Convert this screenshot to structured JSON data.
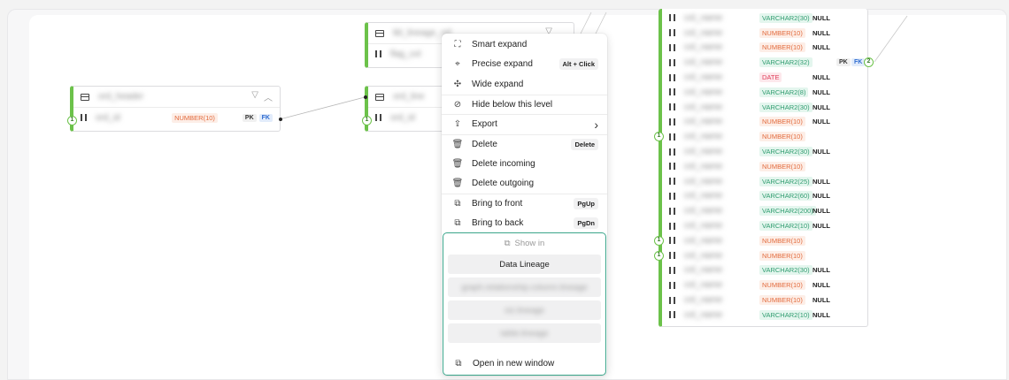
{
  "menu": {
    "items": [
      {
        "icon": "smart-expand-icon",
        "glyph": "⛶",
        "label": "Smart expand",
        "shortcut": ""
      },
      {
        "icon": "precise-expand-icon",
        "glyph": "⌖",
        "label": "Precise expand",
        "shortcut": "Alt + Click"
      },
      {
        "icon": "wide-expand-icon",
        "glyph": "✣",
        "label": "Wide expand",
        "shortcut": ""
      },
      {
        "icon": "eye-off-icon",
        "glyph": "⊘",
        "label": "Hide below this level",
        "shortcut": ""
      },
      {
        "icon": "export-icon",
        "glyph": "⇪",
        "label": "Export",
        "shortcut": "›"
      },
      {
        "icon": "trash-icon",
        "glyph": "🗑",
        "label": "Delete",
        "shortcut": "Delete"
      },
      {
        "icon": "trash-icon",
        "glyph": "🗑",
        "label": "Delete incoming",
        "shortcut": ""
      },
      {
        "icon": "trash-icon",
        "glyph": "🗑",
        "label": "Delete outgoing",
        "shortcut": ""
      },
      {
        "icon": "bring-front-icon",
        "glyph": "⧉",
        "label": "Bring to front",
        "shortcut": "PgUp"
      },
      {
        "icon": "send-back-icon",
        "glyph": "⧉",
        "label": "Bring to back",
        "shortcut": "PgDn"
      }
    ],
    "show_in": {
      "title": "Show in",
      "options": [
        "Data Lineage"
      ]
    },
    "open_new_window": "Open in new window"
  },
  "nodes": {
    "left": {
      "type": "NUMBER(10)",
      "pk": "PK",
      "fk": "FK",
      "port": "1"
    },
    "mid_top": {},
    "mid_bottom": {
      "port": "1"
    },
    "right": {
      "rows": [
        {
          "type": "VARCHAR2(30)",
          "kind": "var",
          "null": "NULL"
        },
        {
          "type": "NUMBER(10)",
          "kind": "num",
          "null": "NULL"
        },
        {
          "type": "NUMBER(10)",
          "kind": "num",
          "null": "NULL"
        },
        {
          "type": "VARCHAR2(32)",
          "kind": "var",
          "null": "",
          "pk": "PK",
          "fk": "FK",
          "port_right": "2"
        },
        {
          "type": "DATE",
          "kind": "date",
          "null": "NULL"
        },
        {
          "type": "VARCHAR2(8)",
          "kind": "var",
          "null": "NULL"
        },
        {
          "type": "VARCHAR2(30)",
          "kind": "var",
          "null": "NULL"
        },
        {
          "type": "NUMBER(10)",
          "kind": "num",
          "null": "NULL"
        },
        {
          "type": "NUMBER(10)",
          "kind": "num",
          "null": "",
          "port_left": "1"
        },
        {
          "type": "VARCHAR2(30)",
          "kind": "var",
          "null": "NULL"
        },
        {
          "type": "NUMBER(10)",
          "kind": "num",
          "null": ""
        },
        {
          "type": "VARCHAR2(25)",
          "kind": "var",
          "null": "NULL"
        },
        {
          "type": "VARCHAR2(60)",
          "kind": "var",
          "null": "NULL"
        },
        {
          "type": "VARCHAR2(200)",
          "kind": "var",
          "null": "NULL"
        },
        {
          "type": "VARCHAR2(10)",
          "kind": "var",
          "null": "NULL"
        },
        {
          "type": "NUMBER(10)",
          "kind": "num",
          "null": "",
          "port_left": "1"
        },
        {
          "type": "NUMBER(10)",
          "kind": "num",
          "null": "",
          "port_left": "1"
        },
        {
          "type": "VARCHAR2(30)",
          "kind": "var",
          "null": "NULL"
        },
        {
          "type": "NUMBER(10)",
          "kind": "num",
          "null": "NULL"
        },
        {
          "type": "NUMBER(10)",
          "kind": "num",
          "null": "NULL"
        },
        {
          "type": "VARCHAR2(10)",
          "kind": "var",
          "null": "NULL"
        }
      ]
    }
  },
  "colors": {
    "accent_green": "#6cc24a",
    "menu_highlight": "#3aa58a"
  }
}
